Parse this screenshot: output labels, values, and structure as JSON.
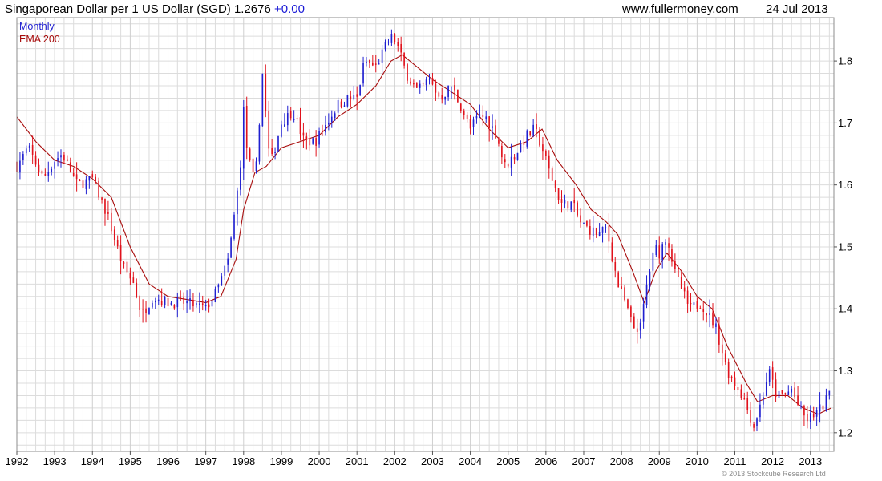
{
  "header": {
    "title": "Singaporean Dollar per 1 US Dollar (SGD) 1.2676",
    "change": "+0.00",
    "site": "www.fullermoney.com",
    "date": "24 Jul 2013"
  },
  "copyright": "© 2013 Stockcube Research Ltd",
  "colors": {
    "up": "#1f1fd0",
    "down": "#e0121c",
    "ema": "#a80c0c",
    "grid": "#dcdcdc",
    "frame": "#8c8c8c",
    "monthly_label": "#1f1fd0",
    "ema_label": "#a80c0c"
  },
  "chart_data": {
    "type": "candlestick",
    "legend": [
      "Monthly",
      "EMA 200"
    ],
    "legend_position": "top-left",
    "grid": true,
    "x_range": [
      1992.0,
      2013.62
    ],
    "y_range": [
      1.17,
      1.87
    ],
    "x_ticks": [
      "1992",
      "1993",
      "1994",
      "1995",
      "1996",
      "1997",
      "1998",
      "1999",
      "2000",
      "2001",
      "2002",
      "2003",
      "2004",
      "2005",
      "2006",
      "2007",
      "2008",
      "2009",
      "2010",
      "2011",
      "2012",
      "2013"
    ],
    "y_ticks": [
      "1.2",
      "1.3",
      "1.4",
      "1.5",
      "1.6",
      "1.7",
      "1.8"
    ],
    "y_tick_values": [
      1.2,
      1.3,
      1.4,
      1.5,
      1.6,
      1.7,
      1.8
    ],
    "close_anchors": [
      [
        1992.0,
        1.63
      ],
      [
        1992.3,
        1.66
      ],
      [
        1992.7,
        1.61
      ],
      [
        1993.0,
        1.64
      ],
      [
        1993.2,
        1.65
      ],
      [
        1993.6,
        1.6
      ],
      [
        1994.0,
        1.61
      ],
      [
        1994.4,
        1.55
      ],
      [
        1994.8,
        1.47
      ],
      [
        1995.1,
        1.44
      ],
      [
        1995.3,
        1.39
      ],
      [
        1995.6,
        1.42
      ],
      [
        1996.0,
        1.41
      ],
      [
        1996.5,
        1.41
      ],
      [
        1997.0,
        1.4
      ],
      [
        1997.3,
        1.43
      ],
      [
        1997.6,
        1.48
      ],
      [
        1997.9,
        1.62
      ],
      [
        1998.0,
        1.72
      ],
      [
        1998.1,
        1.65
      ],
      [
        1998.3,
        1.6
      ],
      [
        1998.5,
        1.78
      ],
      [
        1998.7,
        1.63
      ],
      [
        1999.0,
        1.7
      ],
      [
        1999.3,
        1.72
      ],
      [
        1999.6,
        1.67
      ],
      [
        1999.9,
        1.67
      ],
      [
        2000.2,
        1.7
      ],
      [
        2000.5,
        1.73
      ],
      [
        2000.8,
        1.74
      ],
      [
        2001.0,
        1.74
      ],
      [
        2001.2,
        1.8
      ],
      [
        2001.5,
        1.79
      ],
      [
        2001.8,
        1.83
      ],
      [
        2001.95,
        1.84
      ],
      [
        2002.1,
        1.82
      ],
      [
        2002.3,
        1.78
      ],
      [
        2002.6,
        1.75
      ],
      [
        2002.9,
        1.77
      ],
      [
        2003.2,
        1.74
      ],
      [
        2003.5,
        1.76
      ],
      [
        2003.8,
        1.72
      ],
      [
        2004.0,
        1.69
      ],
      [
        2004.2,
        1.71
      ],
      [
        2004.4,
        1.71
      ],
      [
        2004.7,
        1.68
      ],
      [
        2004.9,
        1.63
      ],
      [
        2005.2,
        1.65
      ],
      [
        2005.5,
        1.68
      ],
      [
        2005.7,
        1.69
      ],
      [
        2005.9,
        1.66
      ],
      [
        2006.1,
        1.62
      ],
      [
        2006.4,
        1.57
      ],
      [
        2006.7,
        1.57
      ],
      [
        2006.9,
        1.54
      ],
      [
        2007.1,
        1.53
      ],
      [
        2007.4,
        1.52
      ],
      [
        2007.6,
        1.53
      ],
      [
        2007.9,
        1.44
      ],
      [
        2008.1,
        1.41
      ],
      [
        2008.3,
        1.37
      ],
      [
        2008.5,
        1.37
      ],
      [
        2008.7,
        1.45
      ],
      [
        2008.9,
        1.5
      ],
      [
        2009.0,
        1.49
      ],
      [
        2009.2,
        1.52
      ],
      [
        2009.4,
        1.46
      ],
      [
        2009.6,
        1.43
      ],
      [
        2009.8,
        1.4
      ],
      [
        2010.1,
        1.41
      ],
      [
        2010.3,
        1.39
      ],
      [
        2010.5,
        1.37
      ],
      [
        2010.8,
        1.3
      ],
      [
        2011.0,
        1.28
      ],
      [
        2011.2,
        1.26
      ],
      [
        2011.5,
        1.21
      ],
      [
        2011.7,
        1.25
      ],
      [
        2011.9,
        1.3
      ],
      [
        2012.1,
        1.26
      ],
      [
        2012.3,
        1.26
      ],
      [
        2012.5,
        1.27
      ],
      [
        2012.7,
        1.24
      ],
      [
        2012.9,
        1.22
      ],
      [
        2013.1,
        1.23
      ],
      [
        2013.3,
        1.24
      ],
      [
        2013.55,
        1.2676
      ]
    ],
    "ema_points": [
      [
        1992.0,
        1.71
      ],
      [
        1992.5,
        1.67
      ],
      [
        1993.0,
        1.64
      ],
      [
        1993.5,
        1.63
      ],
      [
        1994.0,
        1.61
      ],
      [
        1994.5,
        1.58
      ],
      [
        1995.0,
        1.5
      ],
      [
        1995.5,
        1.44
      ],
      [
        1996.0,
        1.42
      ],
      [
        1996.5,
        1.415
      ],
      [
        1997.0,
        1.41
      ],
      [
        1997.4,
        1.42
      ],
      [
        1997.8,
        1.48
      ],
      [
        1998.0,
        1.56
      ],
      [
        1998.3,
        1.62
      ],
      [
        1998.6,
        1.63
      ],
      [
        1999.0,
        1.66
      ],
      [
        1999.5,
        1.67
      ],
      [
        2000.0,
        1.68
      ],
      [
        2000.5,
        1.71
      ],
      [
        2001.0,
        1.73
      ],
      [
        2001.5,
        1.76
      ],
      [
        2001.9,
        1.8
      ],
      [
        2002.2,
        1.81
      ],
      [
        2002.6,
        1.79
      ],
      [
        2003.0,
        1.77
      ],
      [
        2003.5,
        1.75
      ],
      [
        2004.0,
        1.73
      ],
      [
        2004.5,
        1.69
      ],
      [
        2005.0,
        1.66
      ],
      [
        2005.5,
        1.67
      ],
      [
        2005.9,
        1.69
      ],
      [
        2006.3,
        1.64
      ],
      [
        2006.8,
        1.6
      ],
      [
        2007.2,
        1.56
      ],
      [
        2007.6,
        1.54
      ],
      [
        2007.9,
        1.52
      ],
      [
        2008.3,
        1.46
      ],
      [
        2008.6,
        1.41
      ],
      [
        2008.9,
        1.46
      ],
      [
        2009.2,
        1.49
      ],
      [
        2009.6,
        1.46
      ],
      [
        2010.0,
        1.42
      ],
      [
        2010.4,
        1.4
      ],
      [
        2010.8,
        1.34
      ],
      [
        2011.3,
        1.28
      ],
      [
        2011.6,
        1.25
      ],
      [
        2012.0,
        1.26
      ],
      [
        2012.4,
        1.26
      ],
      [
        2012.8,
        1.24
      ],
      [
        2013.2,
        1.23
      ],
      [
        2013.55,
        1.24
      ]
    ]
  }
}
